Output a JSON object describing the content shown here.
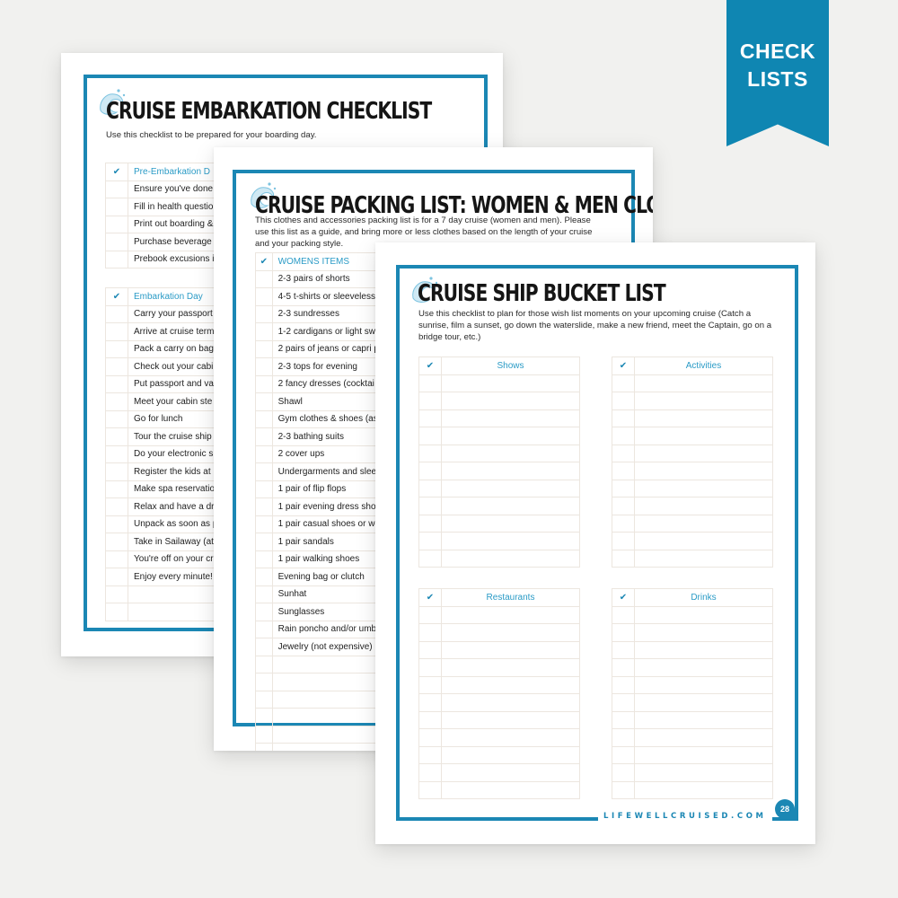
{
  "ribbon": {
    "line1": "CHECK",
    "line2": "LISTS"
  },
  "check_mark": "✔",
  "embarkation": {
    "title": "CRUISE EMBARKATION CHECKLIST",
    "description": "Use this checklist to be prepared for your boarding day.",
    "sections": [
      {
        "header": "Pre-Embarkation D",
        "items": [
          "Ensure you've done",
          "Fill in health questio",
          "Print out boarding &",
          "Purchase beverage",
          "Prebook excusions i"
        ]
      },
      {
        "header": "Embarkation Day",
        "items": [
          "Carry your passport",
          "Arrive at cruise term",
          "Pack a carry on bag",
          "Check out your cabi",
          "Put passport and va",
          "Meet your cabin ste",
          "Go for lunch",
          "Tour the cruise ship",
          "Do your electronic s",
          "Register the kids at",
          "Make spa reservatio",
          "Relax and have a dri",
          "Unpack as soon as p",
          "Take in Sailaway (at",
          "You're off on your cr",
          "Enjoy every minute!",
          "",
          ""
        ]
      }
    ]
  },
  "packing": {
    "title": "CRUISE PACKING LIST: WOMEN & MEN CLOTHES",
    "description": "This clothes and accessories packing list is for a 7 day cruise (women and men). Please use this list as a guide, and bring more or less clothes based on the length of your cruise and your packing style.",
    "header": "WOMENS ITEMS",
    "items": [
      "2-3 pairs of shorts",
      "4-5 t-shirts or sleeveless",
      "2-3 sundresses",
      "1-2 cardigans or light sw",
      "2 pairs of jeans or capri p",
      "2-3 tops for evening",
      "2 fancy dresses (cocktai",
      "Shawl",
      "Gym clothes & shoes (as",
      "2-3 bathing suits",
      "2 cover ups",
      "Undergarments and slee",
      "1 pair of flip flops",
      "1 pair evening dress sho",
      "1 pair casual shoes or we",
      "1 pair sandals",
      "1 pair walking shoes",
      "Evening bag or clutch",
      "Sunhat",
      "Sunglasses",
      "Rain poncho and/or umbr",
      "Jewelry (not expensive)",
      "",
      "",
      "",
      "",
      "",
      ""
    ]
  },
  "bucket": {
    "title": "CRUISE SHIP BUCKET LIST",
    "description": "Use this checklist to plan for those wish list moments on your upcoming cruise (Catch a sunrise, film a sunset, go down the waterslide, make a new friend, meet the Captain, go on a bridge tour, etc.)",
    "tables": [
      {
        "header": "Shows",
        "rows": 11
      },
      {
        "header": "Activities",
        "rows": 11
      },
      {
        "header": "Restaurants",
        "rows": 11
      },
      {
        "header": "Drinks",
        "rows": 11
      }
    ],
    "footer_url": "LIFEWELLCRUISED.COM",
    "page_number": "28"
  },
  "colors": {
    "accent": "#1b87b4",
    "header_text": "#2a9bc6",
    "ribbon": "#0f86b2",
    "background": "#f1f1ef"
  }
}
